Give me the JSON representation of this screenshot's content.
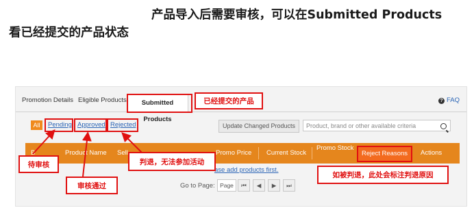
{
  "heading": {
    "line1": "产品导入后需要审核，可以在Submitted Products",
    "line2": "看已经提交的产品状态"
  },
  "tabs": [
    {
      "label": "Promotion Details"
    },
    {
      "label": "Eligible Products"
    },
    {
      "label": "Submitted Products"
    }
  ],
  "faq": {
    "label": "FAQ",
    "icon": "question-circle-icon"
  },
  "filters": {
    "all": "All",
    "pending": "Pending",
    "approved": "Approved",
    "rejected": "Rejected"
  },
  "update_button": "Update Changed Products",
  "search": {
    "placeholder": "Product, brand or other available criteria",
    "icon": "search-icon"
  },
  "table": {
    "columns": [
      "Product Name",
      "Promo Price",
      "Current Stock",
      "Promo Stock",
      "Reject Reasons",
      "Actions"
    ],
    "partial_columns": [
      "B",
      "Sell"
    ]
  },
  "add_products_text": "ase add products first.",
  "pagination": {
    "label": "Go to Page:",
    "page_placeholder": "Page",
    "first": "⏮",
    "prev": "◀",
    "next": "▶",
    "last": "⏭"
  },
  "callouts": {
    "submitted": "已经提交的产品",
    "pending": "待审核",
    "approved": "审核通过",
    "rejected": "判退，无法参加活动",
    "reason": "如被判退，此处会标注判退原因"
  },
  "colors": {
    "accent_orange": "#e5861d",
    "annotation_red": "#e01010",
    "link_blue": "#2a64b5"
  }
}
